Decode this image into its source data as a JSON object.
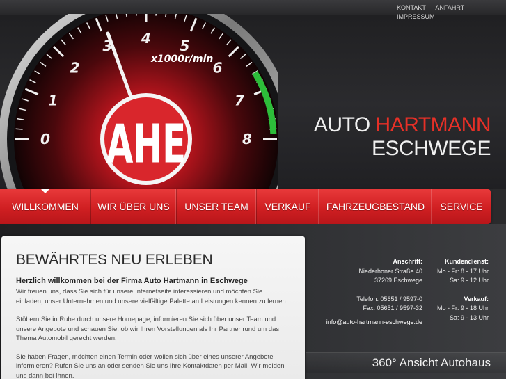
{
  "topnav": {
    "items": [
      "KONTAKT",
      "ANFAHRT",
      "IMPRESSUM"
    ]
  },
  "header": {
    "brand_line1_a": "AUTO ",
    "brand_line1_b": "HARTMANN",
    "brand_line2": "ESCHWEGE",
    "logo_text": "AHE",
    "gauge_unit": "x1000r/min",
    "gauge_ticks": [
      "0",
      "1",
      "2",
      "3",
      "4",
      "5",
      "6",
      "7",
      "8"
    ]
  },
  "mainnav": {
    "items": [
      "WILLKOMMEN",
      "WIR ÜBER UNS",
      "UNSER TEAM",
      "VERKAUF",
      "FAHRZEUGBESTAND",
      "SERVICE"
    ],
    "active": "WILLKOMMEN"
  },
  "content": {
    "title": "BEWÄHRTES NEU ERLEBEN",
    "subtitle": "Herzlich willkommen bei der Firma Auto Hartmann in Eschwege",
    "p1": "Wir freuen uns, dass Sie sich für unsere Internetseite interessieren und möchten Sie einladen, unser Unternehmen und unsere vielfältige Palette an Leistungen kennen zu lernen.",
    "p2": "Stöbern Sie in Ruhe durch unsere Homepage, informieren Sie sich über unser Team und unsere Angebote und schauen Sie, ob wir Ihren Vorstellungen als Ihr Partner rund um das Thema Automobil gerecht werden.",
    "p3": "Sie haben Fragen, möchten einen Termin oder wollen sich über eines unserer Angebote informieren? Rufen Sie uns an oder senden Sie uns Ihre Kontaktdaten per Mail. Wir melden uns dann bei Ihnen."
  },
  "contact": {
    "address_label": "Anschrift:",
    "street": "Niederhoner Straße 40",
    "city": "37269 Eschwege",
    "phone": "Telefon: 05651 / 9597-0",
    "fax": "Fax: 05651 / 9597-32",
    "email": "info@auto-hartmann-eschwege.de",
    "service_label": "Kundendienst:",
    "service_weekdays": "Mo - Fr: 8 - 17 Uhr",
    "service_saturday": "Sa: 9 - 12 Uhr",
    "sales_label": "Verkauf:",
    "sales_weekdays": "Mo - Fr: 9 - 18 Uhr",
    "sales_saturday": "Sa: 9 - 13 Uhr"
  },
  "footer": {
    "ansicht": "360° Ansicht Autohaus"
  },
  "colors": {
    "accent": "#d8242a",
    "nav_red": "#d01f22",
    "green": "#2dbd3a",
    "dark": "#2a2a2c"
  }
}
